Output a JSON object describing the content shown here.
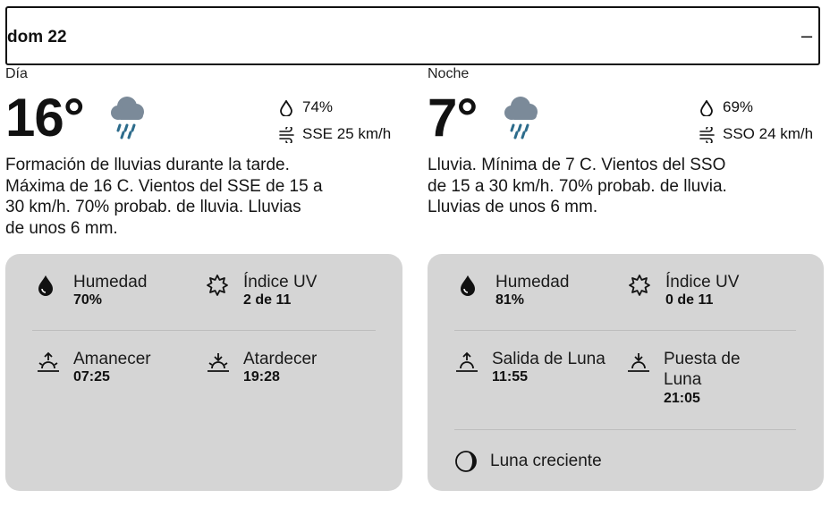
{
  "header": {
    "title": "dom 22",
    "toggle": "–"
  },
  "day": {
    "label": "Día",
    "temp": "16°",
    "icon": "rain-cloud-icon",
    "humidity_pct": "74%",
    "wind": "SSE 25 km/h",
    "description": [
      "Formación de lluvias durante la tarde.",
      "Máxima de 16 C. Vientos del SSE de 15 a",
      "30 km/h. 70% probab. de lluvia. Lluvias",
      "de unos 6 mm."
    ],
    "details": {
      "humidity_label": "Humedad",
      "humidity_value": "70%",
      "uv_label": "Índice UV",
      "uv_value": "2 de 11",
      "sunrise_label": "Amanecer",
      "sunrise_value": "07:25",
      "sunset_label": "Atardecer",
      "sunset_value": "19:28"
    }
  },
  "night": {
    "label": "Noche",
    "temp": "7°",
    "icon": "rain-cloud-icon",
    "humidity_pct": "69%",
    "wind": "SSO 24 km/h",
    "description": [
      "Lluvia. Mínima de 7 C. Vientos del SSO",
      "de 15 a 30 km/h. 70% probab. de lluvia.",
      "Lluvias de unos 6 mm."
    ],
    "details": {
      "humidity_label": "Humedad",
      "humidity_value": "81%",
      "uv_label": "Índice UV",
      "uv_value": "0 de 11",
      "moonrise_label": "Salida de Luna",
      "moonrise_value": "11:55",
      "moonset_label_1": "Puesta de",
      "moonset_label_2": "Luna",
      "moonset_value": "21:05",
      "moon_phase": "Luna creciente"
    }
  },
  "colors": {
    "card_bg": "#d5d5d5",
    "icon_cloud": "#7b8a99",
    "icon_rain": "#2d6c8c"
  }
}
